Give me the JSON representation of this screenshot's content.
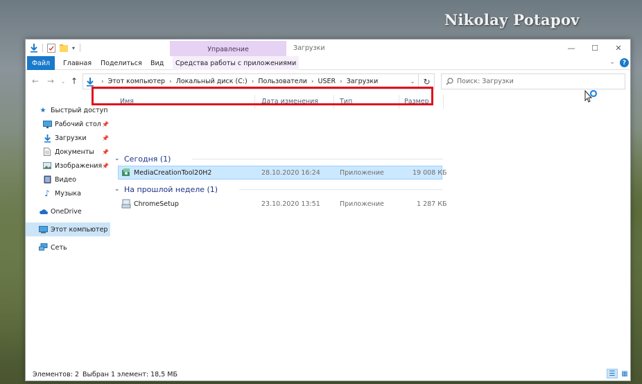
{
  "watermark": "Nikolay Potapov",
  "window": {
    "title": "Загрузки",
    "context_tab_group": "Управление"
  },
  "ribbon": {
    "tabs": [
      "Файл",
      "Главная",
      "Поделиться",
      "Вид",
      "Средства работы с приложениями"
    ]
  },
  "address": {
    "breadcrumbs": [
      "Этот компьютер",
      "Локальный диск (C:)",
      "Пользователи",
      "USER",
      "Загрузки"
    ]
  },
  "search": {
    "placeholder": "Поиск: Загрузки"
  },
  "sidebar": {
    "items": [
      {
        "label": "Быстрый доступ",
        "icon": "star-icon",
        "pinned": false
      },
      {
        "label": "Рабочий стол",
        "icon": "desktop-icon",
        "pinned": true
      },
      {
        "label": "Загрузки",
        "icon": "download-icon",
        "pinned": true
      },
      {
        "label": "Документы",
        "icon": "document-icon",
        "pinned": true
      },
      {
        "label": "Изображения",
        "icon": "picture-icon",
        "pinned": true
      },
      {
        "label": "Видео",
        "icon": "video-icon",
        "pinned": false
      },
      {
        "label": "Музыка",
        "icon": "music-icon",
        "pinned": false
      },
      {
        "label": "OneDrive",
        "icon": "cloud-icon",
        "pinned": false
      },
      {
        "label": "Этот компьютер",
        "icon": "computer-icon",
        "pinned": false,
        "selected": true
      },
      {
        "label": "Сеть",
        "icon": "network-icon",
        "pinned": false
      }
    ]
  },
  "columns": [
    "Имя",
    "Дата изменения",
    "Тип",
    "Размер"
  ],
  "groups": [
    {
      "label": "Сегодня (1)",
      "files": [
        {
          "name": "MediaCreationTool20H2",
          "date": "28.10.2020 16:24",
          "type": "Приложение",
          "size": "19 008 КБ",
          "selected": true
        }
      ]
    },
    {
      "label": "На прошлой неделе (1)",
      "files": [
        {
          "name": "ChromeSetup",
          "date": "23.10.2020 13:51",
          "type": "Приложение",
          "size": "1 287 КБ",
          "selected": false
        }
      ]
    }
  ],
  "status": {
    "count": "Элементов: 2",
    "selection": "Выбран 1 элемент: 18,5 МБ"
  }
}
